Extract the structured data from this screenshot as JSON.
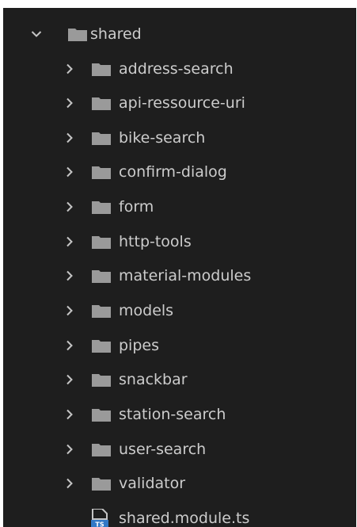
{
  "colors": {
    "background": "#1e1e1e",
    "text": "#cccccc",
    "folder": "#9a9a9a",
    "chevron": "#c5c5c5",
    "ts_icon": "#3178c6"
  },
  "explorer": {
    "root": {
      "label": "shared",
      "icon": "folder-icon",
      "expanded": true
    },
    "children": [
      {
        "label": "address-search",
        "type": "folder"
      },
      {
        "label": "api-ressource-uri",
        "type": "folder"
      },
      {
        "label": "bike-search",
        "type": "folder"
      },
      {
        "label": "confirm-dialog",
        "type": "folder"
      },
      {
        "label": "form",
        "type": "folder"
      },
      {
        "label": "http-tools",
        "type": "folder"
      },
      {
        "label": "material-modules",
        "type": "folder"
      },
      {
        "label": "models",
        "type": "folder"
      },
      {
        "label": "pipes",
        "type": "folder"
      },
      {
        "label": "snackbar",
        "type": "folder"
      },
      {
        "label": "station-search",
        "type": "folder"
      },
      {
        "label": "user-search",
        "type": "folder"
      },
      {
        "label": "validator",
        "type": "folder"
      }
    ],
    "file": {
      "label": "shared.module.ts",
      "icon": "typescript-file-icon",
      "icon_text": "TS"
    }
  }
}
